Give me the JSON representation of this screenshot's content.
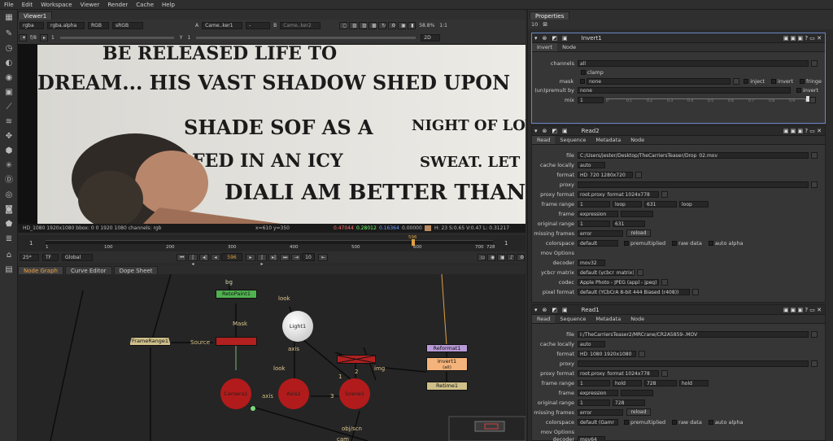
{
  "menu": [
    "File",
    "Edit",
    "Workspace",
    "Viewer",
    "Render",
    "Cache",
    "Help"
  ],
  "viewer": {
    "tab": "Viewer1",
    "row1": [
      "rgba",
      "rgba.alpha",
      "RGB",
      "sRGB",
      "A",
      "Came..ker1",
      "-",
      "B",
      "Came..ker2",
      "58.8%",
      "1:1"
    ],
    "row2": [
      "f/8",
      "1",
      "Y",
      "1",
      "2D"
    ],
    "status_left": "HD_1080 1920x1080  bbox: 0 0 1920 1080 channels: rgb",
    "status_coords": "x=610 y=350",
    "status_values": [
      "0.47044",
      "0.28012",
      "0.16364",
      "0.00000"
    ],
    "status_hsv": "H: 23 S:0.65 V:0.47  L: 0.31217",
    "wall_text": [
      "BE RELEASED LIFE TO",
      "DREAM... HIS VAST SHADOW SHED UPON",
      "SHADE SOF AS A",
      "NIGHT OF LOVE",
      "FED IN AN ICY",
      "SWEAT. LET HI",
      "DIALI AM BETTER THAN HE"
    ]
  },
  "timeline": {
    "ticks": [
      "1",
      "100",
      "200",
      "300",
      "400",
      "500",
      "600",
      "700",
      "728"
    ],
    "start": "1",
    "end": "1",
    "marker": "596",
    "end2": "1"
  },
  "playbar": {
    "zoom": "25*",
    "tf": "TF",
    "scope": "Global",
    "frame": "596",
    "step": "10"
  },
  "node_tabs": [
    "Node Graph",
    "Curve Editor",
    "Dope Sheet"
  ],
  "nodes": {
    "bg": "bg",
    "retopaint": "RetoPaint1",
    "mask": "Mask",
    "framerange": "FrameRange1",
    "source": "Source",
    "look1": "look",
    "light": "Light1",
    "axis1": "axis",
    "look2": "look",
    "axis2": "axis",
    "camera": "Camera1",
    "axis_node": "Axis1",
    "n3": "3",
    "scene": "Scene1",
    "n1": "1",
    "n2": "2",
    "img": "img",
    "objscn": "obj/scn",
    "cam": "cam",
    "reformat": "Reformat1",
    "invert": "Invert1",
    "invert_sub": "(all)",
    "retime": "Retime1"
  },
  "properties": {
    "title": "Properties",
    "count": "10",
    "invert": {
      "name": "Invert1",
      "tabs": [
        "Invert",
        "Node"
      ],
      "channels_label": "channels",
      "channels": "all",
      "clamp": "clamp",
      "mask_label": "mask",
      "mask": "none",
      "inject": "inject",
      "invert_chk": "invert",
      "fringe": "fringe",
      "premult_label": "(un)premult by",
      "premult": "none",
      "invert2": "invert",
      "mix_label": "mix",
      "mix": "1",
      "mix_ticks": [
        "0",
        "0.1",
        "0.2",
        "0.3",
        "0.4",
        "0.5",
        "0.6",
        "0.7",
        "0.8",
        "0.9",
        "1"
      ]
    },
    "read2": {
      "name": "Read2",
      "tabs": [
        "Read",
        "Sequence",
        "Metadata",
        "Node"
      ],
      "rows": [
        {
          "label": "file",
          "value": "C:/Users/jester/Desktop/TheCarriersTeaser/Drop_02.mov"
        },
        {
          "label": "cache locally",
          "value": "auto"
        },
        {
          "label": "format",
          "value": "HD_720 1280x720"
        },
        {
          "label": "proxy",
          "value": ""
        },
        {
          "label": "proxy format",
          "value": "root.proxy_format 1024x778"
        },
        {
          "label": "frame range",
          "value": "1",
          "v2": "loop",
          "v3": "631",
          "v4": "loop"
        },
        {
          "label": "frame",
          "value": "expression"
        },
        {
          "label": "original range",
          "value": "1",
          "v3": "631"
        },
        {
          "label": "missing frames",
          "value": "error",
          "btn": "reload"
        },
        {
          "label": "colorspace",
          "value": "default",
          "c1": "premultiplied",
          "c2": "raw data",
          "c3": "auto alpha"
        },
        {
          "label": "mov Options",
          "value": ""
        },
        {
          "label": "decoder",
          "value": "mov32"
        },
        {
          "label": "ycbcr matrix",
          "value": "default (ycbcr_matrix)"
        },
        {
          "label": "codec",
          "value": "Apple Photo - JPEG (appl - jpeg)"
        },
        {
          "label": "pixel format",
          "value": "default (YCbCrA 8-bit 444 Biased (r408))"
        }
      ]
    },
    "read1": {
      "name": "Read1",
      "tabs": [
        "Read",
        "Sequence",
        "Metadata",
        "Node"
      ],
      "rows": [
        {
          "label": "file",
          "value": "I:/TheCarriersTeaser2/MRCrane/CR2A5859-.MOV"
        },
        {
          "label": "cache locally",
          "value": "auto"
        },
        {
          "label": "format",
          "value": "HD_1080 1920x1080"
        },
        {
          "label": "proxy",
          "value": ""
        },
        {
          "label": "proxy format",
          "value": "root.proxy_format 1024x778"
        },
        {
          "label": "frame range",
          "value": "1",
          "v2": "hold",
          "v3": "728",
          "v4": "hold"
        },
        {
          "label": "frame",
          "value": "expression"
        },
        {
          "label": "original range",
          "value": "1",
          "v3": "728"
        },
        {
          "label": "missing frames",
          "value": "error",
          "btn": "reload"
        },
        {
          "label": "colorspace",
          "value": "default (Gamr",
          "c1": "premultiplied",
          "c2": "raw data",
          "c3": "auto alpha"
        },
        {
          "label": "mov Options",
          "value": ""
        },
        {
          "label": "decoder",
          "value": "mov64"
        }
      ]
    }
  }
}
